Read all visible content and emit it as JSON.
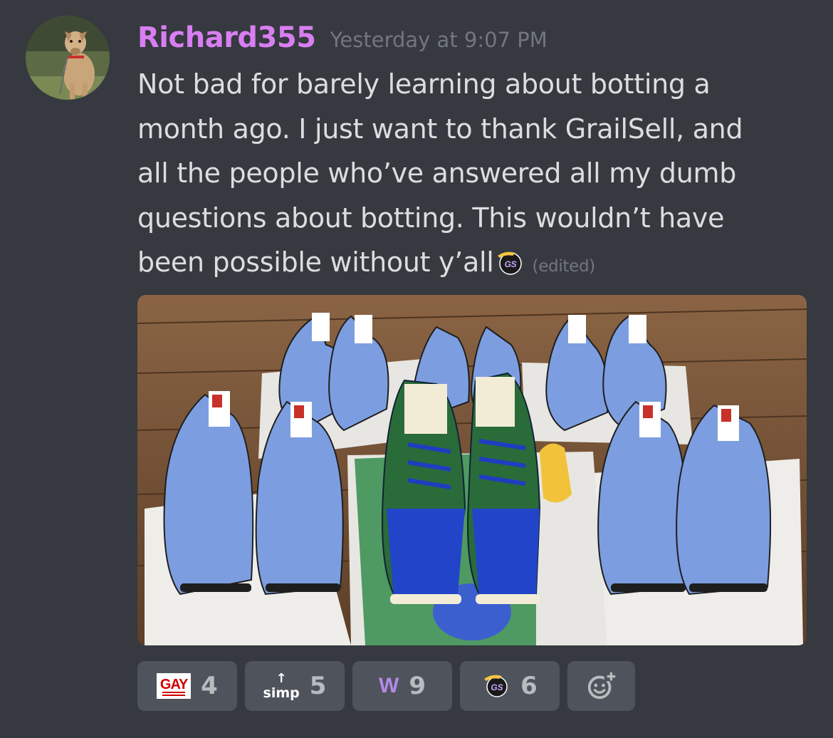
{
  "message": {
    "author": {
      "username": "Richard355",
      "name_color": "#d97ef2",
      "avatar_icon": "dog-photo-avatar"
    },
    "timestamp": "Yesterday at 9:07 PM",
    "content_lines": [
      "Not bad for barely learning about botting a",
      "month ago. I just want to thank GrailSell, and",
      "all the people who’ve answered all my dumb",
      "questions about botting. This wouldn’t have",
      "been possible without y’all"
    ],
    "inline_emoji": "grailsell-gs-emoji",
    "edited_label": "(edited)",
    "attachment": {
      "icon": "sneakers-photo"
    },
    "reactions": [
      {
        "emoji": "gay-100-emoji",
        "emoji_text": "GAY",
        "count": "4"
      },
      {
        "emoji": "simp-up-arrow-emoji",
        "emoji_text": "simp",
        "emoji_arrow": "↑",
        "count": "5"
      },
      {
        "emoji": "w-emoji",
        "emoji_text": "W",
        "count": "9"
      },
      {
        "emoji": "grailsell-gs-emoji",
        "count": "6"
      }
    ],
    "add_reaction_icon": "add-reaction-smiley-icon"
  },
  "colors": {
    "background": "#36393f",
    "text": "#dcddde",
    "muted": "#72767d",
    "reaction_bg": "#4f545c",
    "reaction_count": "#b9bbbe"
  }
}
